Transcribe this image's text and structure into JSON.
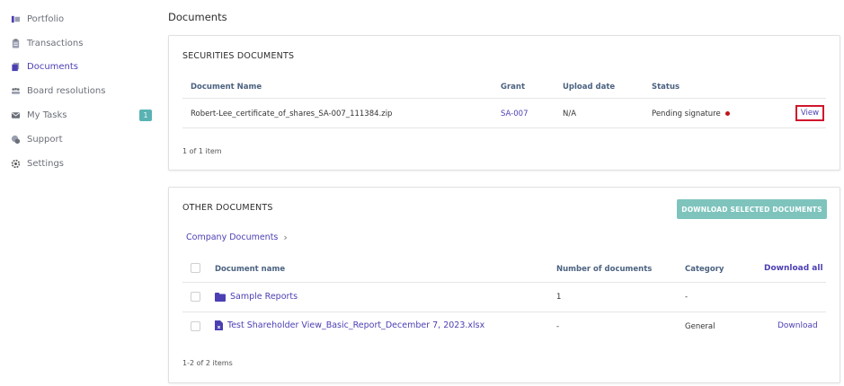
{
  "sidebar": {
    "items": [
      {
        "label": "Portfolio",
        "icon": "portfolio-icon"
      },
      {
        "label": "Transactions",
        "icon": "clipboard-icon"
      },
      {
        "label": "Documents",
        "icon": "documents-icon",
        "active": true
      },
      {
        "label": "Board resolutions",
        "icon": "board-icon"
      },
      {
        "label": "My Tasks",
        "icon": "tasks-icon",
        "badge": "1"
      },
      {
        "label": "Support",
        "icon": "support-icon"
      },
      {
        "label": "Settings",
        "icon": "gear-icon"
      }
    ]
  },
  "page": {
    "title": "Documents"
  },
  "securities": {
    "title": "SECURITIES DOCUMENTS",
    "columns": [
      "Document Name",
      "Grant",
      "Upload date",
      "Status"
    ],
    "rows": [
      {
        "name": "Robert-Lee_certificate_of_shares_SA-007_111384.zip",
        "grant": "SA-007",
        "upload_date": "N/A",
        "status": "Pending signature",
        "action": "View"
      }
    ],
    "footer": "1 of 1 item"
  },
  "other": {
    "title": "OTHER DOCUMENTS",
    "download_selected": "DOWNLOAD SELECTED DOCUMENTS",
    "breadcrumb": "Company Documents",
    "columns": [
      "Document name",
      "Number of documents",
      "Category",
      "Download all"
    ],
    "rows": [
      {
        "name": "Sample Reports",
        "count": "1",
        "category": "-",
        "action": ""
      },
      {
        "name": "Test Shareholder View_Basic_Report_December 7, 2023.xlsx",
        "count": "-",
        "category": "General",
        "action": "Download"
      }
    ],
    "footer": "1-2 of 2 items"
  },
  "colors": {
    "accent": "#4b3fb3",
    "teal": "#7ec4bd",
    "badge": "#59b3b3",
    "status_red": "#c0161a",
    "highlight_border": "#d0152d"
  }
}
